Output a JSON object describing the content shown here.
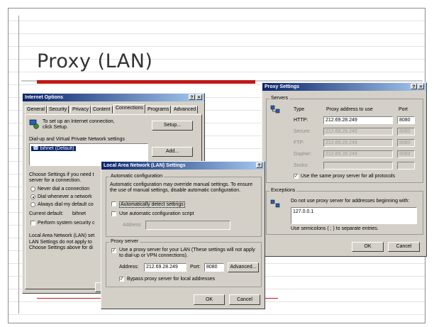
{
  "slide": {
    "title": "Proxy (LAN)"
  },
  "internet_options": {
    "title": "Internet Options",
    "tabs": [
      "General",
      "Security",
      "Privacy",
      "Content",
      "Connections",
      "Programs",
      "Advanced"
    ],
    "active_tab": "Connections",
    "setup_text": "To set up an Internet connection, click Setup.",
    "setup_button": "Setup...",
    "dialup_label": "Dial-up and Virtual Private Network settings",
    "dialup_item": "bihnet (Default)",
    "add_button": "Add...",
    "choose_text": "Choose Settings if you need t",
    "choose_text2": "server for a connection.",
    "radio_never": "Never dial a connection",
    "radio_whenever": "Dial whenever a network",
    "radio_always": "Always dial my default co",
    "current_default": "Current default:",
    "current_default_value": "bihnet",
    "perform_check": "Perform system security c",
    "lan_label": "Local Area Network (LAN) set",
    "lan_text": "LAN Settings do not apply to",
    "lan_text2": "Choose Settings above for di"
  },
  "lan_settings": {
    "title": "Local Area Network (LAN) Settings",
    "auto_group": "Automatic configuration",
    "auto_desc": "Automatic configuration may override manual settings.  To ensure the use of manual settings, disable automatic configuration.",
    "auto_detect": "Automatically detect settings",
    "auto_script": "Use automatic configuration script",
    "address_label": "Address",
    "proxy_group": "Proxy server",
    "use_proxy": "Use a proxy server for your LAN (These settings will not apply to dial-up or VPN connections).",
    "address": "Address:",
    "address_value": "212.69.28.249",
    "port": "Port:",
    "port_value": "8080",
    "advanced_button": "Advanced...",
    "bypass": "Bypass proxy server for local addresses",
    "ok": "OK",
    "cancel": "Cancel"
  },
  "proxy_settings": {
    "title": "Proxy Settings",
    "servers_group": "Servers",
    "col_type": "Type",
    "col_address": "Proxy address to use",
    "col_port": "Port",
    "rows": [
      {
        "type": "HTTP:",
        "address": "212.69.28.249",
        "port": "8080",
        "enabled": true
      },
      {
        "type": "Secure:",
        "address": "212.69.28.249",
        "port": "8080",
        "enabled": false
      },
      {
        "type": "FTP:",
        "address": "212.69.28.249",
        "port": "8080",
        "enabled": false
      },
      {
        "type": "Gopher:",
        "address": "212.69.28.249",
        "port": "8080",
        "enabled": false
      },
      {
        "type": "Socks:",
        "address": "",
        "port": "",
        "enabled": false
      }
    ],
    "same_proxy": "Use the same proxy server for all protocols",
    "exceptions_group": "Exceptions",
    "exceptions_text": "Do not use proxy server for addresses beginning with:",
    "exceptions_value": "127.0.0.1",
    "semicolons": "Use semicolons ( ; ) to separate entries.",
    "ok": "OK",
    "cancel": "Cancel"
  }
}
